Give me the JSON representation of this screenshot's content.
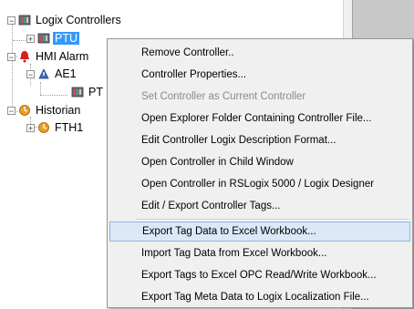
{
  "tree": {
    "root": {
      "label": "Logix Controllers",
      "expander": "−"
    },
    "controller": {
      "label": "PTU",
      "expander": "+"
    },
    "hmi": {
      "label": "HMI Alarm",
      "expander": "−"
    },
    "ae1": {
      "label": "AE1",
      "expander": "−"
    },
    "pt": {
      "label": "PT"
    },
    "historian": {
      "label": "Historian",
      "expander": "−"
    },
    "fth1": {
      "label": "FTH1",
      "expander": "+"
    }
  },
  "context_menu": {
    "items": [
      {
        "label": "Remove Controller..",
        "state": "normal"
      },
      {
        "label": "Controller Properties...",
        "state": "normal"
      },
      {
        "label": "Set Controller as Current Controller",
        "state": "disabled"
      },
      {
        "label": "Open Explorer Folder Containing Controller File...",
        "state": "normal"
      },
      {
        "label": "Edit Controller Logix Description Format...",
        "state": "normal"
      },
      {
        "label": "Open Controller in Child Window",
        "state": "normal"
      },
      {
        "label": "Open Controller in RSLogix 5000 / Logix Designer",
        "state": "normal"
      },
      {
        "label": "Edit / Export Controller Tags...",
        "state": "normal"
      },
      {
        "label": "Export Tag Data to Excel Workbook...",
        "state": "hover"
      },
      {
        "label": "Import Tag Data from Excel Workbook...",
        "state": "normal"
      },
      {
        "label": "Export Tags to Excel OPC Read/Write Workbook...",
        "state": "normal"
      },
      {
        "label": "Export Tag Meta Data to Logix Localization File...",
        "state": "normal"
      }
    ]
  },
  "colors": {
    "selection": "#3399ff",
    "menu_hover": "#dbe8f8",
    "menu_bg": "#f0f0f0",
    "alarm_red": "#d42020"
  }
}
